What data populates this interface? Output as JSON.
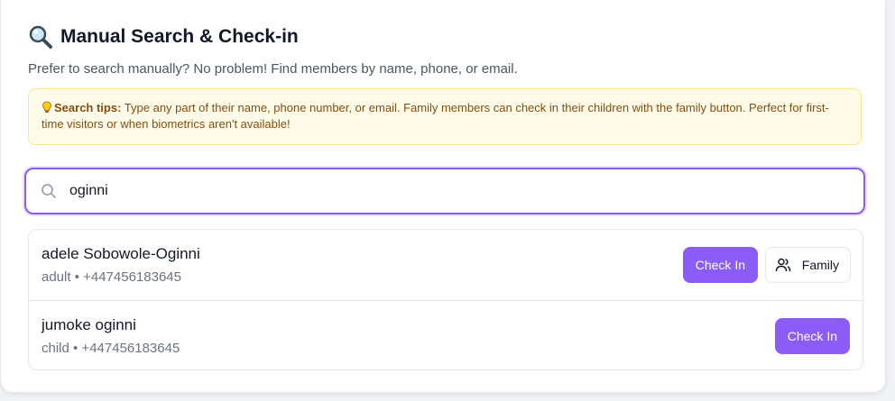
{
  "header": {
    "title": "Manual Search & Check-in",
    "subtitle": "Prefer to search manually? No problem! Find members by name, phone, or email."
  },
  "tips": {
    "label": "Search tips:",
    "text": " Type any part of their name, phone number, or email. Family members can check in their children with the family button. Perfect for first-time visitors or when biometrics aren't available!"
  },
  "search": {
    "value": "oginni"
  },
  "results": [
    {
      "name": "adele Sobowole-Oginni",
      "meta": "adult • +447456183645",
      "checkin_label": "Check In",
      "family_label": "Family"
    },
    {
      "name": "jumoke oginni",
      "meta": "child • +447456183645",
      "checkin_label": "Check In"
    }
  ],
  "colors": {
    "accent": "#8b5cf6",
    "tips_bg": "#fefce8",
    "tips_border": "#fde68a",
    "tips_text": "#854d0e"
  },
  "icons": {
    "title_icon": "magnifying-glass-icon",
    "tips_icon": "lightbulb-icon",
    "search_icon": "search-icon",
    "family_icon": "users-icon"
  }
}
